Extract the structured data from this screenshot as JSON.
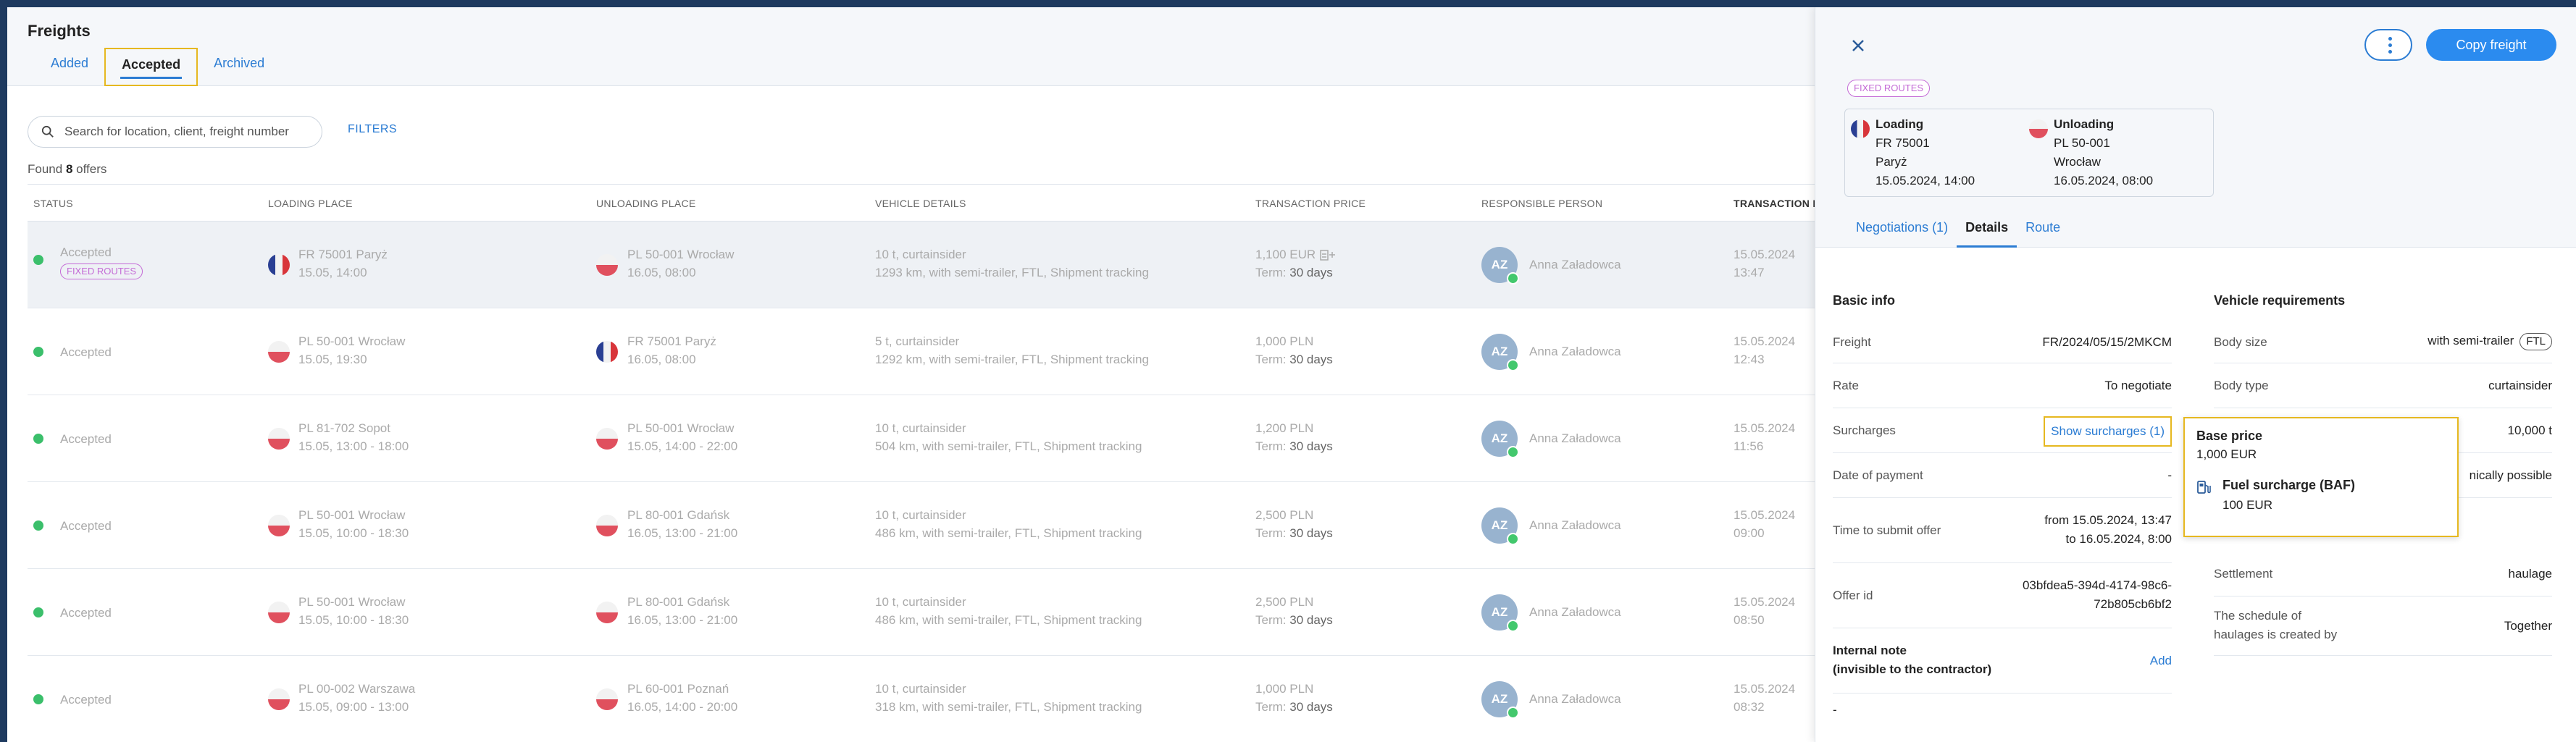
{
  "page": {
    "title": "Freights",
    "tabs": [
      {
        "label": "Added"
      },
      {
        "label": "Accepted"
      },
      {
        "label": "Archived"
      }
    ]
  },
  "search": {
    "placeholder": "Search for location, client, freight number",
    "filters_label": "FILTERS"
  },
  "results": {
    "found_prefix": "Found",
    "count": "8",
    "found_suffix": "offers"
  },
  "table": {
    "headers": {
      "status": "STATUS",
      "loading": "LOADING PLACE",
      "unloading": "UNLOADING PLACE",
      "vehicle": "VEHICLE DETAILS",
      "price": "TRANSACTION PRICE",
      "person": "RESPONSIBLE PERSON",
      "date": "TRANSACTION D"
    },
    "rows": [
      {
        "status": "Accepted",
        "chip": "FIXED ROUTES",
        "load_flag": "fr",
        "load_1": "FR 75001 Paryż",
        "load_2": "15.05, 14:00",
        "unload_flag": "pl",
        "unload_1": "PL 50-001 Wrocław",
        "unload_2": "16.05, 08:00",
        "veh_1": "10 t, curtainsider",
        "veh_2": "1293 km, with semi-trailer, FTL, Shipment tracking",
        "price": "1,100 EUR",
        "term_label": "Term:",
        "term": "30 days",
        "initials": "AZ",
        "person": "Anna Załadowca",
        "date_1": "15.05.2024",
        "date_2": "13:47"
      },
      {
        "status": "Accepted",
        "chip": "",
        "load_flag": "pl",
        "load_1": "PL 50-001 Wrocław",
        "load_2": "15.05, 19:30",
        "unload_flag": "fr",
        "unload_1": "FR 75001 Paryż",
        "unload_2": "16.05, 08:00",
        "veh_1": "5 t, curtainsider",
        "veh_2": "1292 km, with semi-trailer, FTL, Shipment tracking",
        "price": "1,000 PLN",
        "term_label": "Term:",
        "term": "30 days",
        "initials": "AZ",
        "person": "Anna Załadowca",
        "date_1": "15.05.2024",
        "date_2": "12:43"
      },
      {
        "status": "Accepted",
        "chip": "",
        "load_flag": "pl",
        "load_1": "PL 81-702 Sopot",
        "load_2": "15.05, 13:00 - 18:00",
        "unload_flag": "pl",
        "unload_1": "PL 50-001 Wrocław",
        "unload_2": "15.05, 14:00 - 22:00",
        "veh_1": "10 t, curtainsider",
        "veh_2": "504 km, with semi-trailer, FTL, Shipment tracking",
        "price": "1,200 PLN",
        "term_label": "Term:",
        "term": "30 days",
        "initials": "AZ",
        "person": "Anna Załadowca",
        "date_1": "15.05.2024",
        "date_2": "11:56"
      },
      {
        "status": "Accepted",
        "chip": "",
        "load_flag": "pl",
        "load_1": "PL 50-001 Wrocław",
        "load_2": "15.05, 10:00 - 18:30",
        "unload_flag": "pl",
        "unload_1": "PL 80-001 Gdańsk",
        "unload_2": "16.05, 13:00 - 21:00",
        "veh_1": "10 t, curtainsider",
        "veh_2": "486 km, with semi-trailer, FTL, Shipment tracking",
        "price": "2,500 PLN",
        "term_label": "Term:",
        "term": "30 days",
        "initials": "AZ",
        "person": "Anna Załadowca",
        "date_1": "15.05.2024",
        "date_2": "09:00"
      },
      {
        "status": "Accepted",
        "chip": "",
        "load_flag": "pl",
        "load_1": "PL 50-001 Wrocław",
        "load_2": "15.05, 10:00 - 18:30",
        "unload_flag": "pl",
        "unload_1": "PL 80-001 Gdańsk",
        "unload_2": "16.05, 13:00 - 21:00",
        "veh_1": "10 t, curtainsider",
        "veh_2": "486 km, with semi-trailer, FTL, Shipment tracking",
        "price": "2,500 PLN",
        "term_label": "Term:",
        "term": "30 days",
        "initials": "AZ",
        "person": "Anna Załadowca",
        "date_1": "15.05.2024",
        "date_2": "08:50"
      },
      {
        "status": "Accepted",
        "chip": "",
        "load_flag": "pl",
        "load_1": "PL 00-002 Warszawa",
        "load_2": "15.05, 09:00 - 13:00",
        "unload_flag": "pl",
        "unload_1": "PL 60-001 Poznań",
        "unload_2": "16.05, 14:00 - 20:00",
        "veh_1": "10 t, curtainsider",
        "veh_2": "318 km, with semi-trailer, FTL, Shipment tracking",
        "price": "1,000 PLN",
        "term_label": "Term:",
        "term": "30 days",
        "initials": "AZ",
        "person": "Anna Załadowca",
        "date_1": "15.05.2024",
        "date_2": "08:32"
      }
    ]
  },
  "panel": {
    "copy_label": "Copy freight",
    "chip": "FIXED ROUTES",
    "loading": {
      "label": "Loading",
      "code": "FR 75001",
      "city": "Paryż",
      "date": "15.05.2024, 14:00"
    },
    "unloading": {
      "label": "Unloading",
      "code": "PL 50-001",
      "city": "Wrocław",
      "date": "16.05.2024, 08:00"
    },
    "tabs": [
      {
        "label": "Negotiations (1)"
      },
      {
        "label": "Details"
      },
      {
        "label": "Route"
      }
    ],
    "basic": {
      "title": "Basic info",
      "freight_k": "Freight",
      "freight_v": "FR/2024/05/15/2MKCM",
      "rate_k": "Rate",
      "rate_v": "To negotiate",
      "surcharges_k": "Surcharges",
      "surcharges_v": "Show surcharges (1)",
      "payment_k": "Date of payment",
      "payment_v": "-",
      "submit_k": "Time to submit offer",
      "submit_v1": "from 15.05.2024, 13:47",
      "submit_v2": "to 16.05.2024, 8:00",
      "offer_k": "Offer id",
      "offer_v1": "03bfdea5-394d-4174-98c6-",
      "offer_v2": "72b805cb6bf2",
      "note_k1": "Internal note",
      "note_k2": "(invisible to the contractor)",
      "note_add": "Add",
      "note_v": "-"
    },
    "vehicle": {
      "title": "Vehicle requirements",
      "body_size_k": "Body size",
      "body_size_v": "with semi-trailer",
      "body_size_badge": "FTL",
      "body_type_k": "Body type",
      "body_type_v": "curtainsider",
      "capacity_v": "10,000 t",
      "partial_v": "nically possible",
      "settlement_k": "Settlement",
      "settlement_v": "haulage",
      "schedule_k1": "The schedule of",
      "schedule_k2": "haulages is created by",
      "schedule_v": "Together"
    },
    "popover": {
      "base_label": "Base price",
      "base_value": "1,000 EUR",
      "fuel_label": "Fuel surcharge (BAF)",
      "fuel_value": "100 EUR"
    }
  }
}
